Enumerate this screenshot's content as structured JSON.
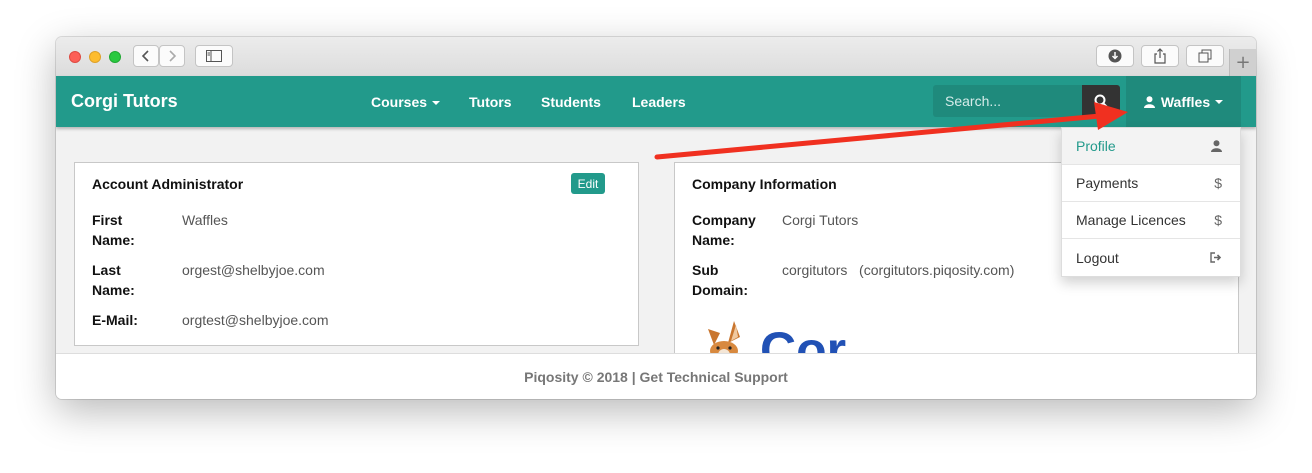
{
  "navbar": {
    "brand": "Corgi Tutors",
    "links": [
      "Courses",
      "Tutors",
      "Students",
      "Leaders"
    ],
    "search_placeholder": "Search...",
    "user_label": "Waffles"
  },
  "account": {
    "title": "Account Administrator",
    "edit_label": "Edit",
    "fields": [
      {
        "label": "First Name:",
        "value": "Waffles"
      },
      {
        "label": "Last Name:",
        "value": "orgest@shelbyjoe.com"
      },
      {
        "label": "E-Mail:",
        "value": "orgtest@shelbyjoe.com"
      }
    ]
  },
  "company": {
    "title": "Company Information",
    "fields": [
      {
        "label": "Company Name:",
        "value": "Corgi Tutors"
      },
      {
        "label": "Sub Domain:",
        "value": "corgitutors   (corgitutors.piqosity.com)"
      }
    ],
    "logo_text": "Cor"
  },
  "dropdown": {
    "items": [
      {
        "label": "Profile",
        "icon": "user-icon",
        "symbol": "👤",
        "active": true
      },
      {
        "label": "Payments",
        "icon": "dollar-icon",
        "symbol": "$"
      },
      {
        "label": "Manage Licences",
        "icon": "dollar-icon",
        "symbol": "$"
      },
      {
        "label": "Logout",
        "icon": "logout-icon",
        "symbol": "⇥"
      }
    ]
  },
  "footer": {
    "text": "Piqosity © 2018 | Get Technical Support"
  },
  "colors": {
    "brand_teal": "#229a8b",
    "arrow_red": "#f03020",
    "logo_blue": "#2151b5"
  }
}
